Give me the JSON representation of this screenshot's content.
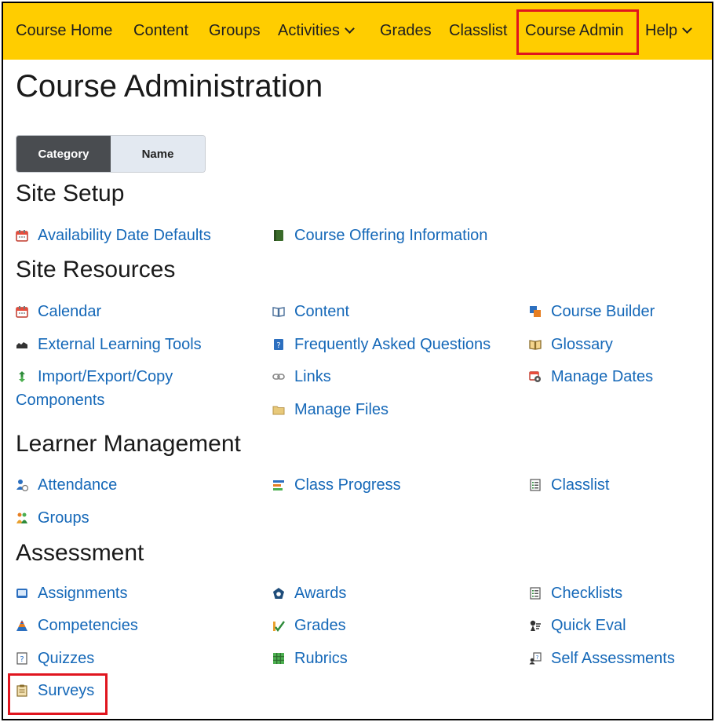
{
  "nav": {
    "items": [
      {
        "label": "Course Home"
      },
      {
        "label": "Content"
      },
      {
        "label": "Groups"
      },
      {
        "label": "Activities"
      },
      {
        "label": "Grades"
      },
      {
        "label": "Classlist"
      },
      {
        "label": "Course Admin"
      },
      {
        "label": "Help"
      }
    ],
    "highlighted_item": "Course Admin",
    "bar_color": "#ffcd00"
  },
  "page": {
    "title": "Course Administration"
  },
  "view_toggle": {
    "options": [
      "Category",
      "Name"
    ],
    "selected": "Category"
  },
  "sections": [
    {
      "title": "Site Setup",
      "items": [
        {
          "label": "Availability Date Defaults",
          "icon": "calendar-icon"
        },
        {
          "label": "Course Offering Information",
          "icon": "book-icon"
        }
      ]
    },
    {
      "title": "Site Resources",
      "items": [
        {
          "label": "Calendar",
          "icon": "calendar-icon"
        },
        {
          "label": "Content",
          "icon": "open-book-icon"
        },
        {
          "label": "Course Builder",
          "icon": "builder-icon"
        },
        {
          "label": "External Learning Tools",
          "icon": "plugin-icon"
        },
        {
          "label": "Frequently Asked Questions",
          "icon": "faq-icon"
        },
        {
          "label": "Glossary",
          "icon": "glossary-icon"
        },
        {
          "label": "Import/Export/Copy Components",
          "icon": "import-export-icon"
        },
        {
          "label": "Links",
          "icon": "link-icon"
        },
        {
          "label": "Manage Dates",
          "icon": "calendar-gear-icon"
        },
        {
          "label": "Manage Files",
          "icon": "folder-icon"
        }
      ]
    },
    {
      "title": "Learner Management",
      "items": [
        {
          "label": "Attendance",
          "icon": "attendance-icon"
        },
        {
          "label": "Class Progress",
          "icon": "progress-icon"
        },
        {
          "label": "Classlist",
          "icon": "classlist-icon"
        },
        {
          "label": "Groups",
          "icon": "groups-icon"
        }
      ]
    },
    {
      "title": "Assessment",
      "items": [
        {
          "label": "Assignments",
          "icon": "assignment-icon"
        },
        {
          "label": "Awards",
          "icon": "award-icon"
        },
        {
          "label": "Checklists",
          "icon": "checklist-icon"
        },
        {
          "label": "Competencies",
          "icon": "competency-icon"
        },
        {
          "label": "Grades",
          "icon": "grades-icon"
        },
        {
          "label": "Quick Eval",
          "icon": "quick-eval-icon"
        },
        {
          "label": "Quizzes",
          "icon": "quiz-icon"
        },
        {
          "label": "Rubrics",
          "icon": "rubric-icon"
        },
        {
          "label": "Self Assessments",
          "icon": "self-assessment-icon"
        },
        {
          "label": "Surveys",
          "icon": "survey-icon"
        }
      ]
    }
  ],
  "highlighted_link": "Surveys",
  "colors": {
    "link": "#1568b8",
    "highlight_border": "#e0151e",
    "toggle_active": "#494c50"
  }
}
